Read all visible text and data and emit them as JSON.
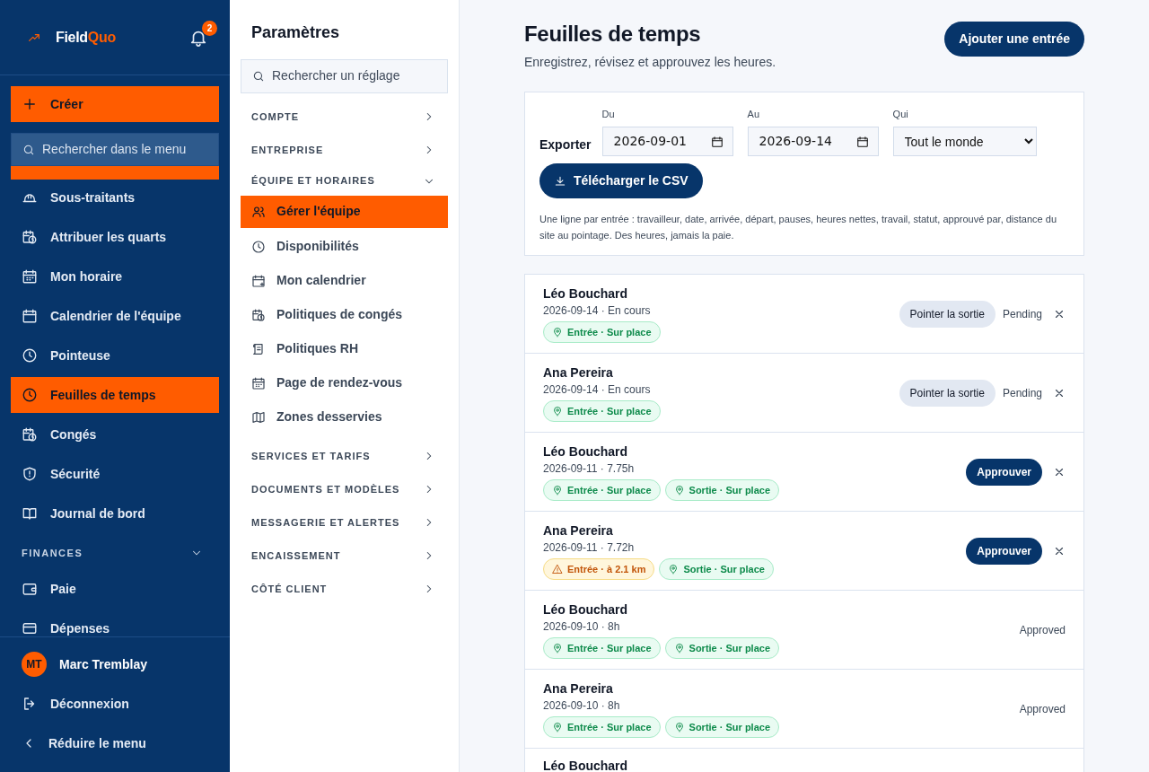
{
  "sidebar": {
    "logo": {
      "text": "Field",
      "accent": "Quo"
    },
    "notifications": "2",
    "create_button": "Créer",
    "search": {
      "placeholder": "Rechercher dans le menu"
    },
    "nav": [
      {
        "kind": "item",
        "label": "Sous-traitants",
        "selected": false
      },
      {
        "kind": "item",
        "label": "Attribuer les quarts",
        "selected": false
      },
      {
        "kind": "item",
        "label": "Mon horaire",
        "selected": false
      },
      {
        "kind": "item",
        "label": "Calendrier de l'équipe",
        "selected": false
      },
      {
        "kind": "item",
        "label": "Pointeuse",
        "selected": false
      },
      {
        "kind": "item",
        "label": "Feuilles de temps",
        "selected": true
      },
      {
        "kind": "item",
        "label": "Congés",
        "selected": false
      },
      {
        "kind": "item",
        "label": "Sécurité",
        "selected": false
      },
      {
        "kind": "item",
        "label": "Journal de bord",
        "selected": false
      },
      {
        "kind": "section",
        "label": "FINANCES",
        "expanded": true
      },
      {
        "kind": "item",
        "label": "Paie",
        "selected": false
      },
      {
        "kind": "item",
        "label": "Dépenses",
        "selected": false
      }
    ],
    "user": {
      "initials": "MT",
      "name": "Marc Tremblay"
    },
    "logout": "Déconnexion",
    "collapse": "Réduire le menu"
  },
  "settings": {
    "title": "Paramètres",
    "search": {
      "placeholder": "Rechercher un réglage"
    },
    "sections": [
      {
        "label": "COMPTE",
        "expanded": false
      },
      {
        "label": "ENTREPRISE",
        "expanded": false
      },
      {
        "label": "ÉQUIPE ET HORAIRES",
        "expanded": true,
        "children": [
          {
            "label": "Gérer l'équipe",
            "selected": true
          },
          {
            "label": "Disponibilités",
            "selected": false
          },
          {
            "label": "Mon calendrier",
            "selected": false
          },
          {
            "label": "Politiques de congés",
            "selected": false
          },
          {
            "label": "Politiques RH",
            "selected": false
          },
          {
            "label": "Page de rendez-vous",
            "selected": false
          },
          {
            "label": "Zones desservies",
            "selected": false
          }
        ]
      },
      {
        "label": "SERVICES ET TARIFS",
        "expanded": false
      },
      {
        "label": "DOCUMENTS ET MODÈLES",
        "expanded": false
      },
      {
        "label": "MESSAGERIE ET ALERTES",
        "expanded": false
      },
      {
        "label": "ENCAISSEMENT",
        "expanded": false
      },
      {
        "label": "CÔTÉ CLIENT",
        "expanded": false
      }
    ]
  },
  "main": {
    "title": "Feuilles de temps",
    "subtitle": "Enregistrez, révisez et approuvez les heures.",
    "add_button": "Ajouter une entrée",
    "export": {
      "label": "Exporter",
      "from": {
        "label": "Du",
        "value": "2026-09-01"
      },
      "to": {
        "label": "Au",
        "value": "2026-09-14"
      },
      "who": {
        "label": "Qui",
        "value": "Tout le monde"
      },
      "download_button": "Télécharger le CSV",
      "note": "Une ligne par entrée : travailleur, date, arrivée, départ, pauses, heures nettes, travail, statut, approuvé par, distance du site au pointage. Des heures, jamais la paie."
    },
    "entries": [
      {
        "name": "Léo Bouchard",
        "meta": "2026-09-14 · En cours",
        "tags": [
          {
            "kind": "ok",
            "text": "Entrée · Sur place"
          }
        ],
        "action": {
          "kind": "clock_out",
          "label": "Pointer la sortie"
        },
        "status": "Pending",
        "dismissible": true
      },
      {
        "name": "Ana Pereira",
        "meta": "2026-09-14 · En cours",
        "tags": [
          {
            "kind": "ok",
            "text": "Entrée · Sur place"
          }
        ],
        "action": {
          "kind": "clock_out",
          "label": "Pointer la sortie"
        },
        "status": "Pending",
        "dismissible": true
      },
      {
        "name": "Léo Bouchard",
        "meta": "2026-09-11 · 7.75h",
        "tags": [
          {
            "kind": "ok",
            "text": "Entrée · Sur place"
          },
          {
            "kind": "ok",
            "text": "Sortie · Sur place"
          }
        ],
        "action": {
          "kind": "approve",
          "label": "Approuver"
        },
        "dismissible": true
      },
      {
        "name": "Ana Pereira",
        "meta": "2026-09-11 · 7.72h",
        "tags": [
          {
            "kind": "warn",
            "text": "Entrée · à 2.1 km"
          },
          {
            "kind": "ok",
            "text": "Sortie · Sur place"
          }
        ],
        "action": {
          "kind": "approve",
          "label": "Approuver"
        },
        "dismissible": true
      },
      {
        "name": "Léo Bouchard",
        "meta": "2026-09-10 · 8h",
        "tags": [
          {
            "kind": "ok",
            "text": "Entrée · Sur place"
          },
          {
            "kind": "ok",
            "text": "Sortie · Sur place"
          }
        ],
        "status": "Approved",
        "dismissible": false
      },
      {
        "name": "Ana Pereira",
        "meta": "2026-09-10 · 8h",
        "tags": [
          {
            "kind": "ok",
            "text": "Entrée · Sur place"
          },
          {
            "kind": "ok",
            "text": "Sortie · Sur place"
          }
        ],
        "status": "Approved",
        "dismissible": false
      },
      {
        "name": "Léo Bouchard"
      }
    ]
  }
}
